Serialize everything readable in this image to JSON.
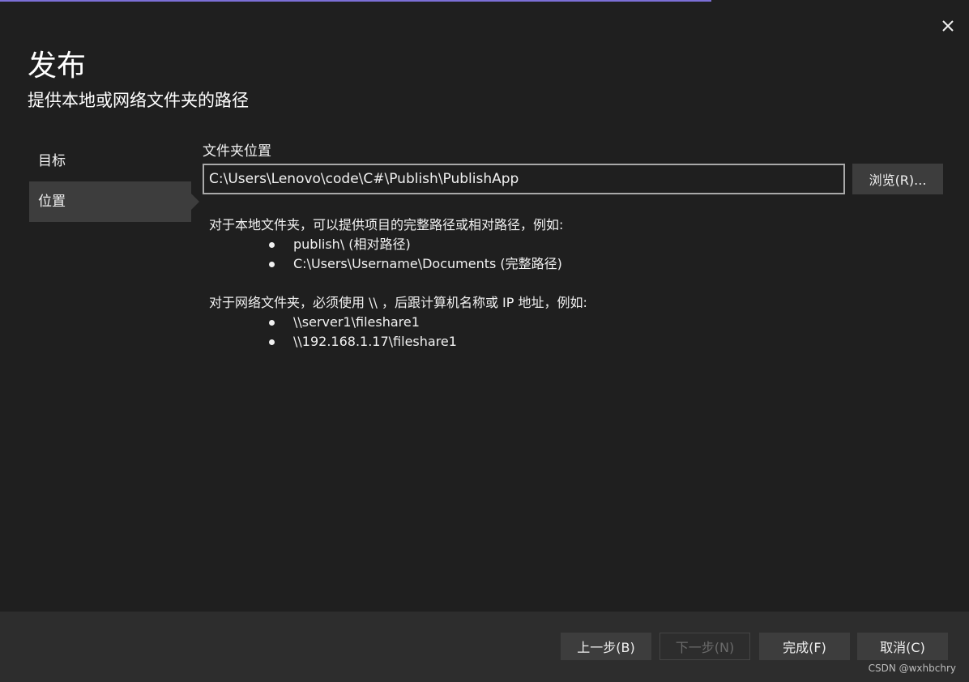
{
  "dialog": {
    "title": "发布",
    "subtitle": "提供本地或网络文件夹的路径",
    "close_icon": "close-icon"
  },
  "nav": {
    "items": [
      {
        "label": "目标",
        "selected": false
      },
      {
        "label": "位置",
        "selected": true
      }
    ]
  },
  "location": {
    "label": "文件夹位置",
    "path_value": "C:\\Users\\Lenovo\\code\\C#\\Publish\\PublishApp",
    "browse_label": "浏览(R)..."
  },
  "help": {
    "local_intro": "对于本地文件夹，可以提供项目的完整路径或相对路径，例如:",
    "local_examples": [
      "publish\\ (相对路径)",
      "C:\\Users\\Username\\Documents (完整路径)"
    ],
    "network_intro": "对于网络文件夹，必须使用 \\\\ ，后跟计算机名称或 IP 地址，例如:",
    "network_examples": [
      "\\\\server1\\fileshare1",
      "\\\\192.168.1.17\\fileshare1"
    ]
  },
  "footer": {
    "prev_label": "上一步(B)",
    "next_label": "下一步(N)",
    "finish_label": "完成(F)",
    "cancel_label": "取消(C)",
    "next_enabled": false
  },
  "watermark": "CSDN @wxhbchry",
  "colors": {
    "background": "#1f1f1f",
    "footer": "#2d2d2d",
    "selected_nav": "#3d3d3d",
    "accent": "#7b6fd6"
  }
}
